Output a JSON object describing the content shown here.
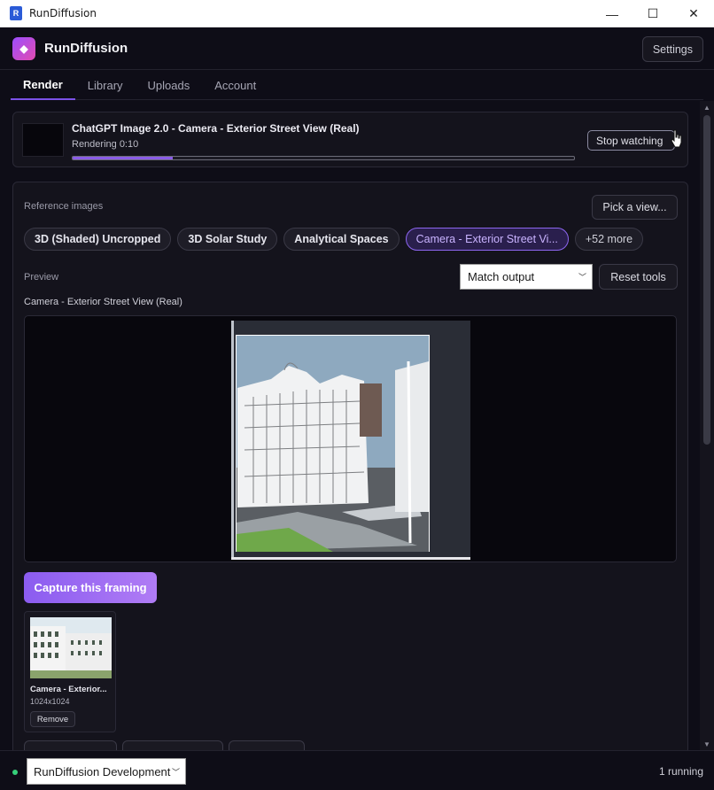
{
  "window": {
    "title": "RunDiffusion",
    "minimize": "—",
    "maximize": "☐",
    "close": "✕"
  },
  "header": {
    "brand": "RunDiffusion",
    "settings_label": "Settings"
  },
  "tabs": [
    {
      "label": "Render",
      "active": true
    },
    {
      "label": "Library",
      "active": false
    },
    {
      "label": "Uploads",
      "active": false
    },
    {
      "label": "Account",
      "active": false
    }
  ],
  "job": {
    "title": "ChatGPT Image 2.0 - Camera - Exterior Street View (Real)",
    "status": "Rendering 0:10",
    "progress": 0.2,
    "stop_label": "Stop watching"
  },
  "references": {
    "section_label": "Reference images",
    "pick_label": "Pick a view...",
    "chips": [
      {
        "label": "3D (Shaded) Uncropped"
      },
      {
        "label": "3D Solar Study"
      },
      {
        "label": "Analytical Spaces"
      },
      {
        "label": "Camera - Exterior Street Vi..."
      },
      {
        "label": "+52 more"
      }
    ],
    "preview_label": "Preview",
    "match_select": "Match output",
    "reset_label": "Reset tools",
    "preview_caption": "Camera - Exterior Street View (Real)",
    "capture_label": "Capture this framing",
    "card": {
      "name": "Camera - Exterior...",
      "size": "1024x1024",
      "remove_label": "Remove"
    }
  },
  "footer": {
    "environment": "RunDiffusion Development",
    "running": "1 running"
  },
  "colors": {
    "accent": "#8a5ce9",
    "background": "#0e0d17",
    "panel": "#14131c",
    "status_ok": "#36d07a"
  }
}
